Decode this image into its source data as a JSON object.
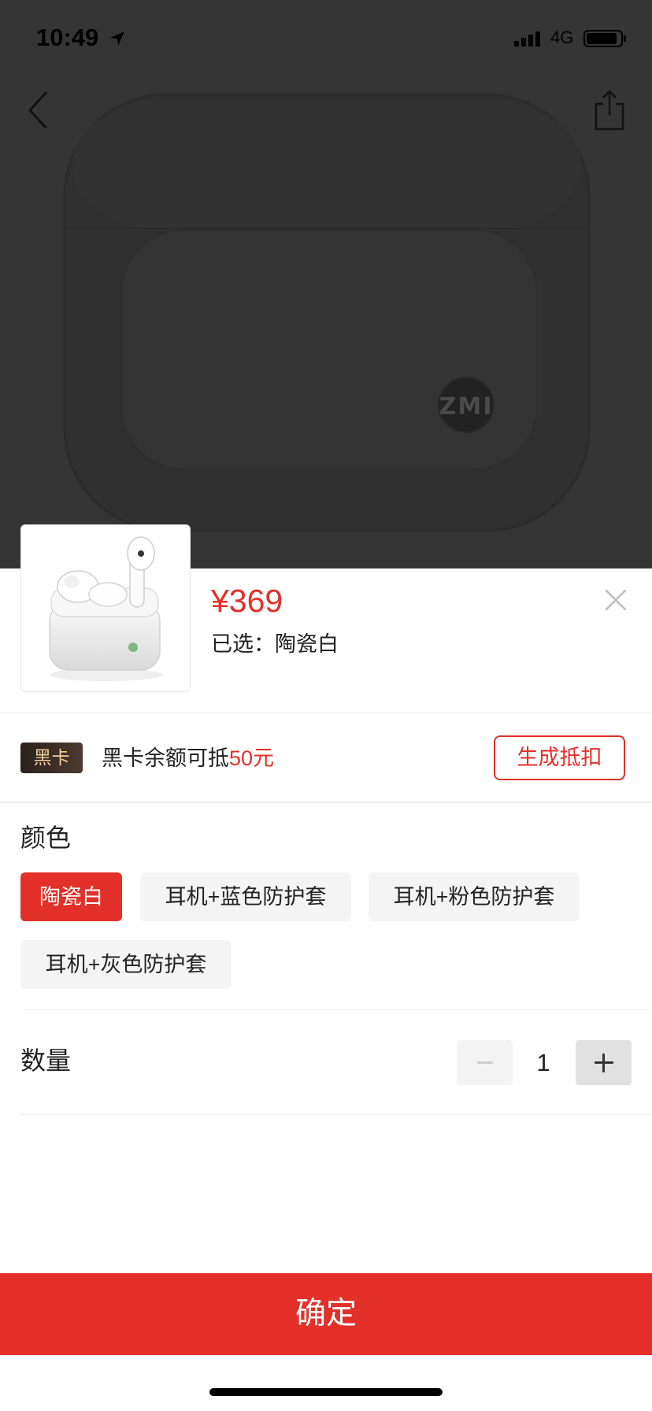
{
  "status_bar": {
    "time": "10:49",
    "network": "4G",
    "icons": [
      "location-arrow-icon",
      "signal-icon",
      "battery-icon"
    ]
  },
  "nav": {
    "back_icon": "chevron-left-icon",
    "share_icon": "share-icon"
  },
  "hero": {
    "case_logo": "ZMI"
  },
  "product": {
    "price": "¥369",
    "selected": "已选：陶瓷白",
    "close_icon": "close-icon"
  },
  "black_card": {
    "badge": "黑卡",
    "text": "黑卡余额可抵",
    "amount": "50元",
    "button": "生成抵扣"
  },
  "color": {
    "title": "颜色",
    "options": [
      {
        "label": "陶瓷白",
        "selected": true
      },
      {
        "label": "耳机+蓝色防护套",
        "selected": false
      },
      {
        "label": "耳机+粉色防护套",
        "selected": false
      },
      {
        "label": "耳机+灰色防护套",
        "selected": false
      }
    ]
  },
  "quantity": {
    "title": "数量",
    "value": "1",
    "minus_icon": "minus-icon",
    "plus_icon": "plus-icon",
    "minus_disabled": true
  },
  "confirm": {
    "label": "确定"
  },
  "colors": {
    "accent": "#e3302a",
    "overlay": "#353535",
    "chip_bg": "#f4f4f4",
    "badge_text": "#efcd98"
  }
}
